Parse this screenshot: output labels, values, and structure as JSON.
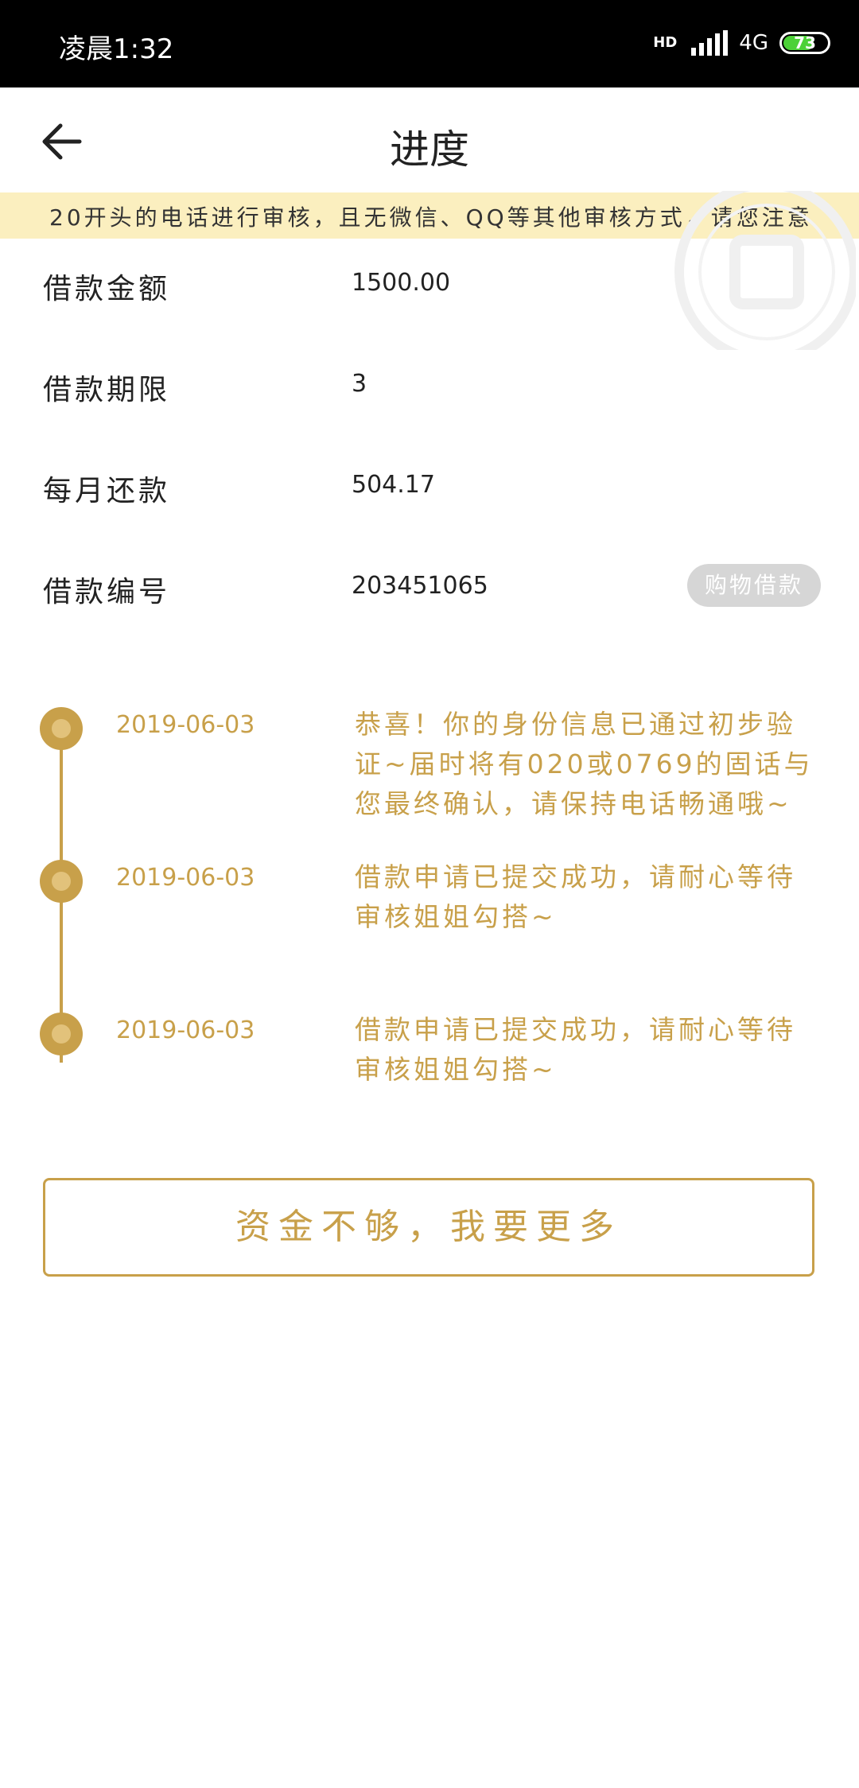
{
  "status_bar": {
    "time": "凌晨1:32",
    "hd_label": "HD",
    "network": "4G",
    "battery": "73"
  },
  "nav": {
    "title": "进度"
  },
  "notice": {
    "text": "20开头的电话进行审核，且无微信、QQ等其他审核方式，请您注意"
  },
  "loan_info": [
    {
      "label": "借款金额",
      "value": "1500.00"
    },
    {
      "label": "借款期限",
      "value": "3"
    },
    {
      "label": "每月还款",
      "value": "504.17"
    },
    {
      "label": "借款编号",
      "value": "203451065"
    }
  ],
  "tag": {
    "label": "购物借款"
  },
  "timeline": [
    {
      "date": "2019-06-03",
      "text": "恭喜！你的身份信息已通过初步验证~届时将有020或0769的固话与您最终确认，请保持电话畅通哦~"
    },
    {
      "date": "2019-06-03",
      "text": "借款申请已提交成功，请耐心等待审核姐姐勾搭~"
    },
    {
      "date": "2019-06-03",
      "text": "借款申请已提交成功，请耐心等待审核姐姐勾搭~"
    }
  ],
  "more_button": {
    "label": "资金不够，我要更多"
  },
  "colors": {
    "accent": "#c8a04a",
    "notice_bg": "#fbefbf",
    "tag_bg": "#d6d6d6"
  }
}
